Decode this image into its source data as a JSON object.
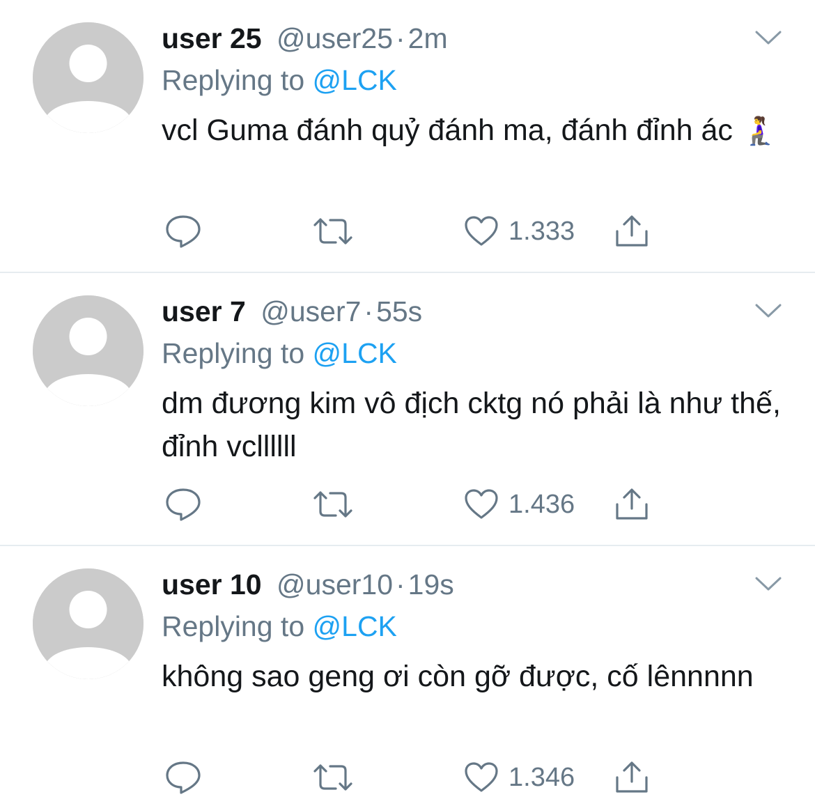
{
  "tweets": [
    {
      "name": "user 25",
      "handle": "@user25",
      "separator": "·",
      "time": "2m",
      "replying_prefix": "Replying to ",
      "replying_to": "@LCK",
      "text": "vcl Guma đánh quỷ đánh ma, đánh đỉnh ác",
      "emoji": "🧎‍♀️",
      "likes": "1.333"
    },
    {
      "name": "user 7",
      "handle": "@user7",
      "separator": "·",
      "time": "55s",
      "replying_prefix": "Replying to ",
      "replying_to": "@LCK",
      "text": "dm đương kim vô địch cktg nó phải là như thế, đỉnh vcllllll",
      "emoji": "",
      "likes": "1.436"
    },
    {
      "name": "user 10",
      "handle": "@user10",
      "separator": "·",
      "time": "19s",
      "replying_prefix": "Replying to ",
      "replying_to": "@LCK",
      "text": "không sao geng ơi còn gỡ được, cố lênnnnn",
      "emoji": "",
      "likes": "1.346"
    }
  ],
  "colors": {
    "secondary_text": "#657786",
    "mention": "#1da1f2",
    "avatar_bg": "#cbcbcb",
    "divider": "#e6ecf0"
  },
  "icons": {
    "reply": "speech-bubble-icon",
    "retweet": "retweet-arrows-icon",
    "like": "heart-outline-icon",
    "share": "share-upload-icon",
    "menu": "chevron-down-icon",
    "avatar": "default-profile-icon"
  }
}
